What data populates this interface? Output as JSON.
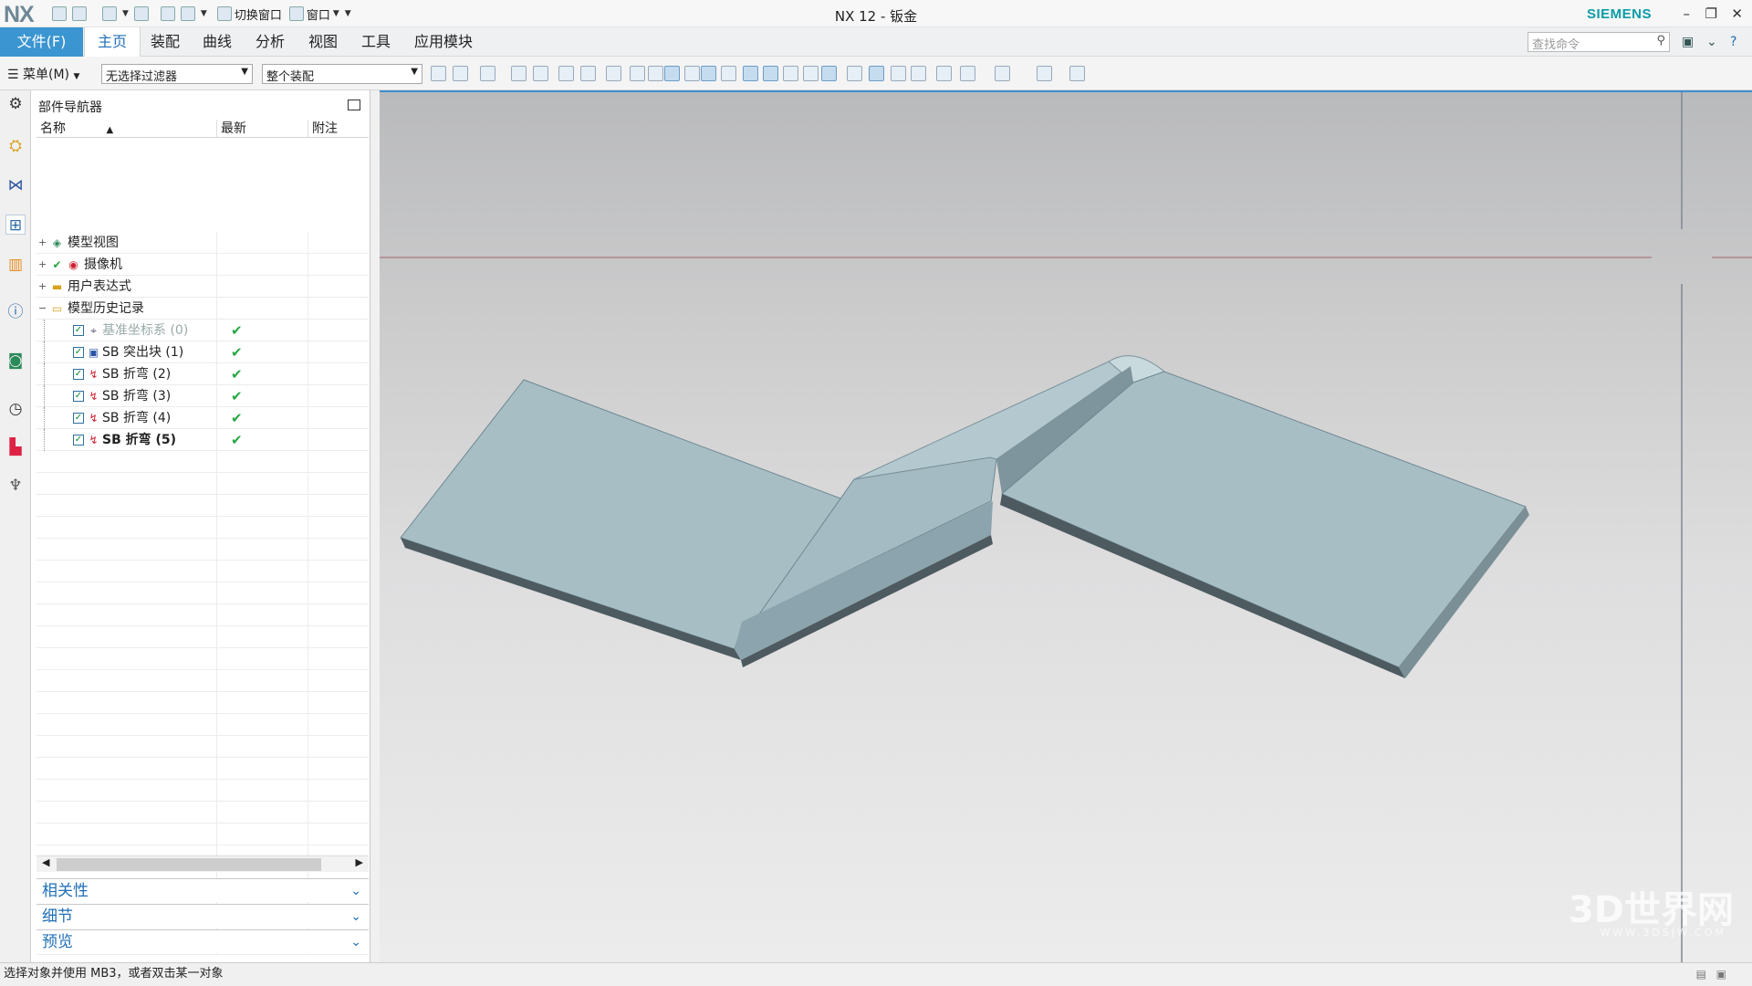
{
  "window": {
    "logo": "NX",
    "title": "NX 12 - 钣金",
    "brand": "SIEMENS",
    "switch_window": "切换窗口",
    "window_menu": "窗口"
  },
  "ribbon": {
    "file_tab": "文件(F)",
    "tabs": [
      "主页",
      "装配",
      "曲线",
      "分析",
      "视图",
      "工具",
      "应用模块"
    ],
    "search_placeholder": "查找命令"
  },
  "toolbar": {
    "menu_label": "菜单(M)",
    "filter_value": "无选择过滤器",
    "assembly_value": "整个装配"
  },
  "navigator": {
    "title": "部件导航器",
    "columns": [
      "名称",
      "最新",
      "附注"
    ],
    "nodes": [
      {
        "label": "模型视图",
        "expander": "+"
      },
      {
        "label": "摄像机",
        "expander": "+"
      },
      {
        "label": "用户表达式",
        "expander": "+"
      },
      {
        "label": "模型历史记录",
        "expander": "−"
      }
    ],
    "features": [
      {
        "label": "基准坐标系 (0)",
        "latest": "✔",
        "style": "gray"
      },
      {
        "label": "SB 突出块 (1)",
        "latest": "✔",
        "style": ""
      },
      {
        "label": "SB 折弯 (2)",
        "latest": "✔",
        "style": ""
      },
      {
        "label": "SB 折弯 (3)",
        "latest": "✔",
        "style": ""
      },
      {
        "label": "SB 折弯 (4)",
        "latest": "✔",
        "style": ""
      },
      {
        "label": "SB 折弯 (5)",
        "latest": "✔",
        "style": "bold"
      }
    ],
    "panels": [
      "相关性",
      "细节",
      "预览"
    ]
  },
  "status": {
    "message": "选择对象并使用 MB3，或者双击某一对象"
  },
  "watermark": {
    "text": "3D世界网",
    "sub": "WWW.3DSJW.COM"
  },
  "colors": {
    "accent": "#3b95d0",
    "part_fill": "#a9bfc6",
    "siemens": "#0a9ba8"
  }
}
